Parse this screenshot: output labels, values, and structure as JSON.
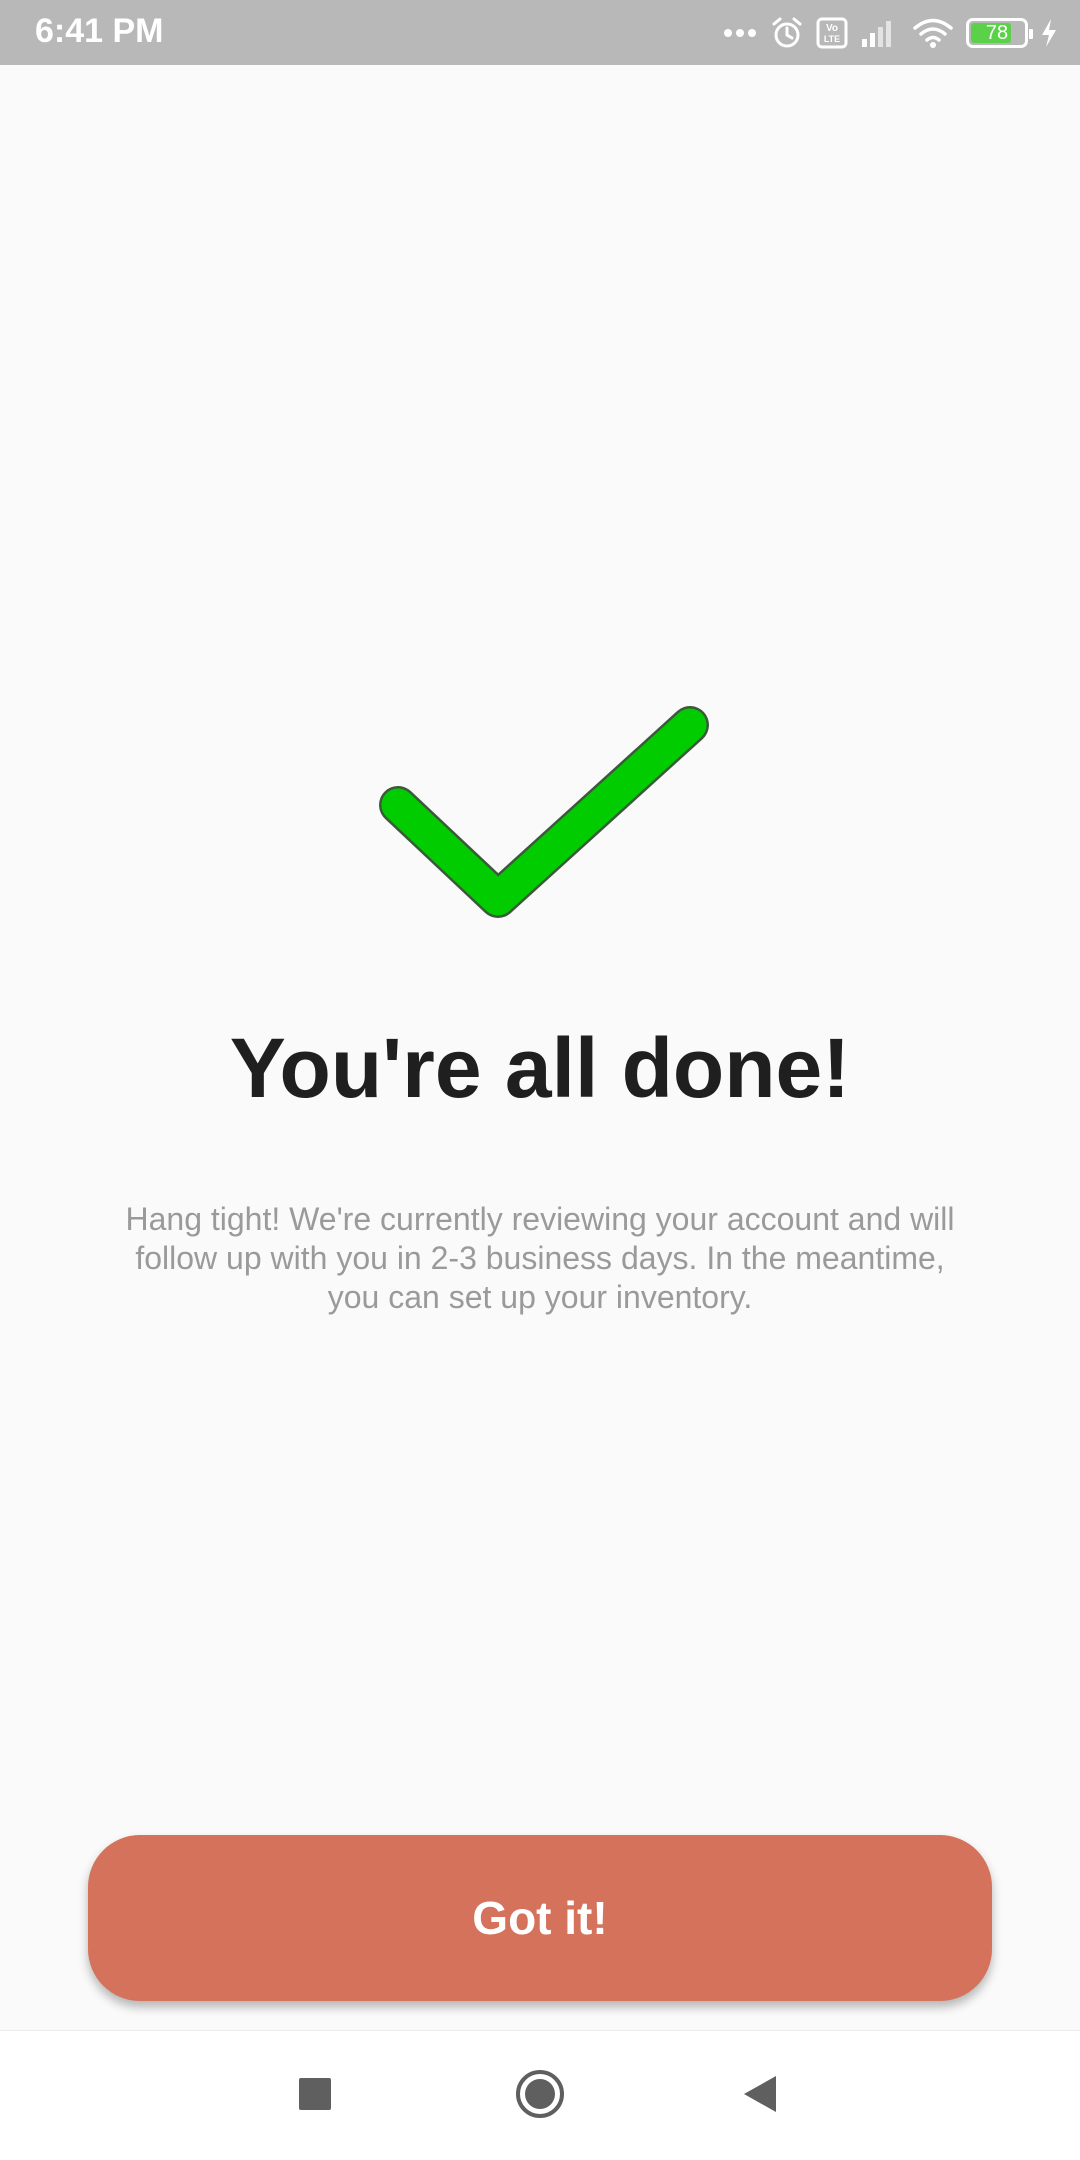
{
  "status_bar": {
    "time": "6:41 PM",
    "battery_level": "78",
    "battery_fraction": 0.78,
    "icons": [
      "more-dots-icon",
      "alarm-icon",
      "volte-icon",
      "signal-icon",
      "wifi-icon",
      "battery-icon",
      "charging-icon"
    ]
  },
  "main": {
    "icon": "checkmark-icon",
    "title": "You're all done!",
    "message": "Hang tight! We're currently reviewing your account and will follow up with you in 2-3 business days. In the meantime, you can set up your inventory.",
    "button_label": "Got it!"
  },
  "nav_bar": {
    "buttons": [
      "recents-square-icon",
      "home-circle-icon",
      "back-triangle-icon"
    ]
  },
  "colors": {
    "status_bar": "#b8b8b8",
    "check_green": "#00cc00",
    "button": "#d4725c",
    "title": "#1f1f1f",
    "message": "#9a9a9a",
    "battery_fill": "#5bd14a"
  }
}
